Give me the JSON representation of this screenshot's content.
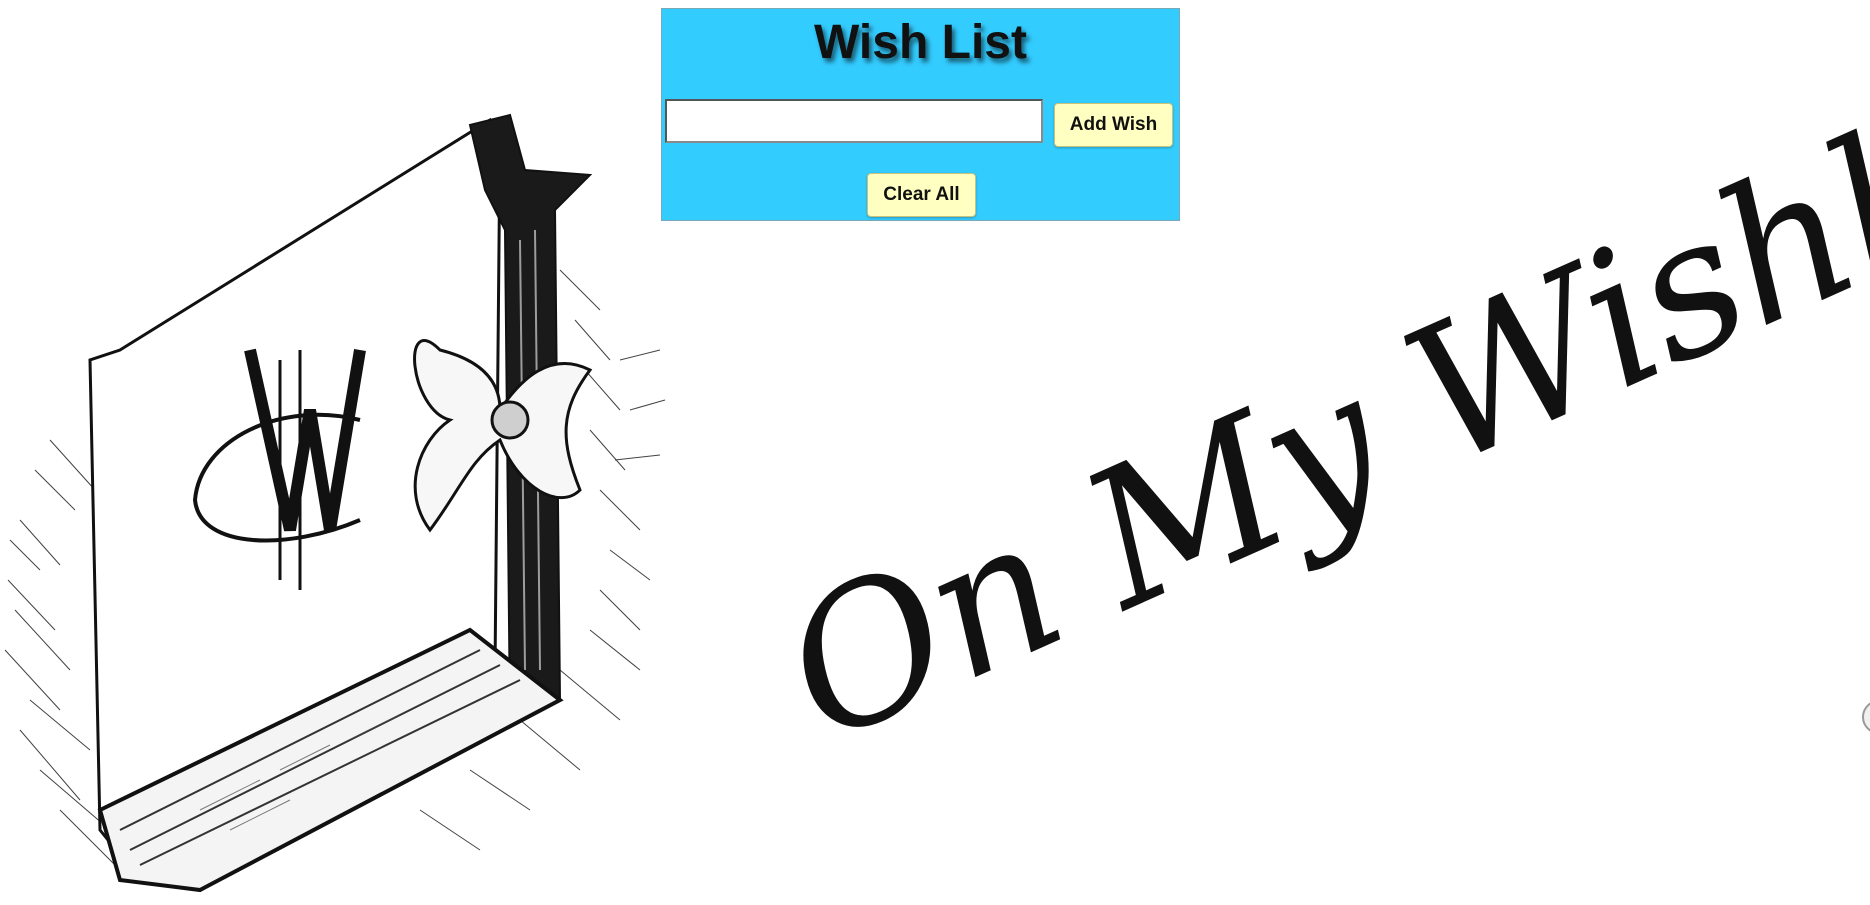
{
  "panel": {
    "title": "Wish List",
    "input": {
      "value": "",
      "placeholder": ""
    },
    "add_button_label": "Add Wish",
    "clear_button_label": "Clear All",
    "background_color": "#33ccff",
    "button_color": "#ffffc2"
  },
  "background": {
    "script_text": "On My Wishlist",
    "illustration": "book-with-bow-monogram",
    "monogram_text": "WC"
  }
}
